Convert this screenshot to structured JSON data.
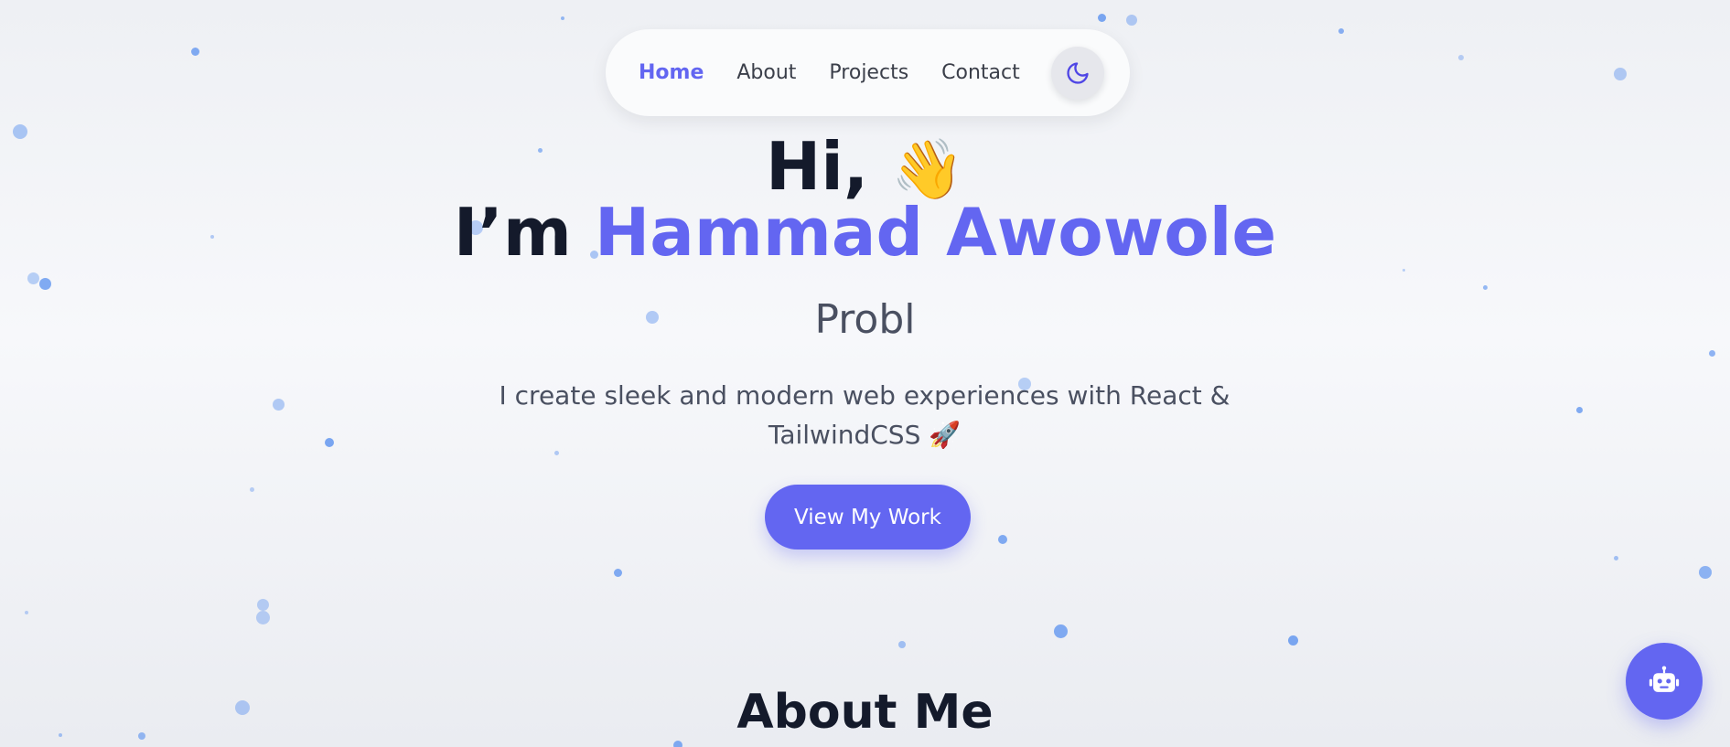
{
  "nav": {
    "items": [
      {
        "label": "Home",
        "active": true
      },
      {
        "label": "About",
        "active": false
      },
      {
        "label": "Projects",
        "active": false
      },
      {
        "label": "Contact",
        "active": false
      }
    ],
    "theme_toggle_icon": "moon-icon"
  },
  "hero": {
    "greeting": "Hi,",
    "greeting_emoji": "👋",
    "intro_prefix": "I’m",
    "name": "Hammad Awowole",
    "typed_text": "Probl",
    "bio": "I create sleek and modern web experiences with React & TailwindCSS 🚀",
    "cta_label": "View My Work"
  },
  "about": {
    "heading": "About Me"
  },
  "chatbot": {
    "icon": "robot-icon"
  },
  "colors": {
    "accent": "#6366f1",
    "heading": "#141a2b",
    "body_text": "#4a5061",
    "particle": "#6b9cf0"
  }
}
